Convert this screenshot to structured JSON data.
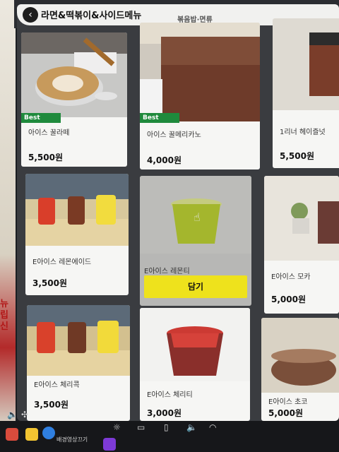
{
  "header": {
    "back_icon": "chevron-left-icon",
    "category_title": "라면&떡볶이&사이드메뉴",
    "next_category": "볶음밥·면류"
  },
  "poster": {
    "text": "뉴 립 신"
  },
  "products": [
    {
      "name": "아이스 꿀라떼",
      "price": "5,500원",
      "badge": "Best"
    },
    {
      "name": "아이스 꿀메리카노",
      "price": "4,000원",
      "badge": "Best"
    },
    {
      "name": "1리너 헤이즐넛",
      "price": "5,500원"
    },
    {
      "name": "E아이스 레몬에이드",
      "price": "3,500원"
    },
    {
      "name": "E아이스 레몬티",
      "add_label": "담기"
    },
    {
      "name": "E아이스 모카",
      "price": "5,000원"
    },
    {
      "name": "E아이스 체리콕",
      "price": "3,500원"
    },
    {
      "name": "E아이스 체리티",
      "price": "3,000원"
    },
    {
      "name": "E아이스 초코",
      "price": "5,000원"
    }
  ],
  "taskbar": {
    "background_video_label": "배경영상끄기",
    "icons": [
      "volume-icon",
      "expand-icon",
      "chrome-icon",
      "folder-icon",
      "edge-icon",
      "brightness-icon",
      "monitor-icon",
      "phone-icon",
      "speaker-icon",
      "wifi-icon"
    ]
  },
  "colors": {
    "accent_add": "#eee21c",
    "badge_best": "#1f8a3c"
  }
}
